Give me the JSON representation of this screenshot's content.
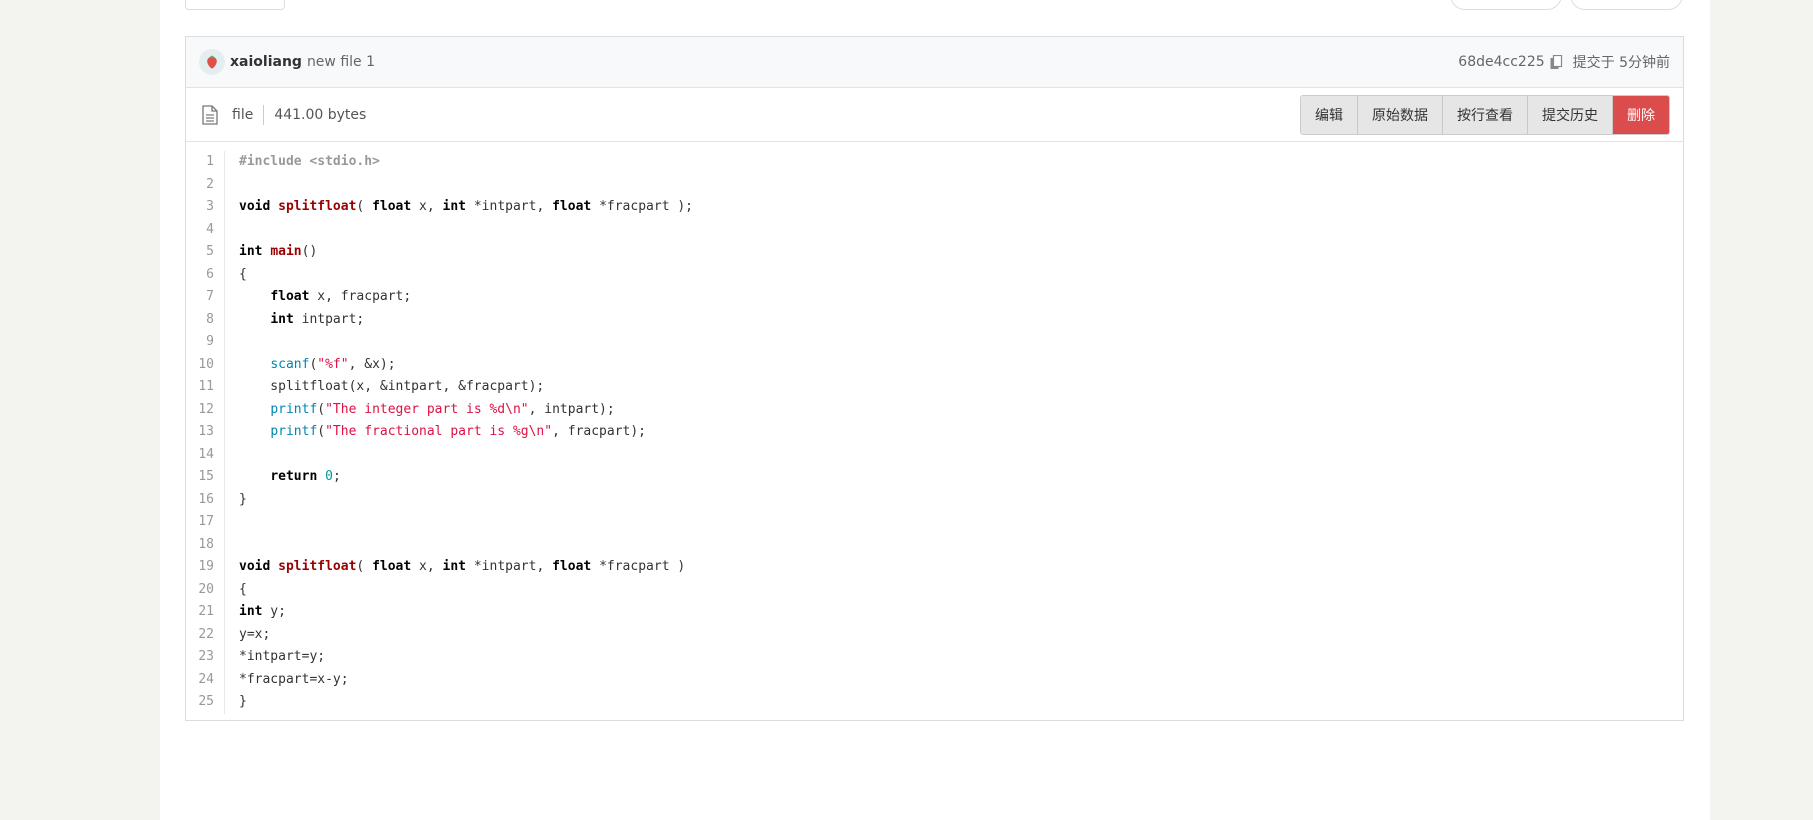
{
  "commit": {
    "author": "xaioliang",
    "message": "new file 1",
    "sha": "68de4cc225",
    "time": "提交于 5分钟前"
  },
  "file": {
    "name": "file",
    "size": "441.00 bytes"
  },
  "actions": {
    "edit": "编辑",
    "raw": "原始数据",
    "blame": "按行查看",
    "history": "提交历史",
    "delete": "删除"
  },
  "code": {
    "lines": [
      "#include <stdio.h>",
      "",
      "void splitfloat( float x, int *intpart, float *fracpart );",
      "",
      "int main()",
      "{",
      "    float x, fracpart;",
      "    int intpart;",
      "",
      "    scanf(\"%f\", &x);",
      "    splitfloat(x, &intpart, &fracpart);",
      "    printf(\"The integer part is %d\\n\", intpart);",
      "    printf(\"The fractional part is %g\\n\", fracpart);",
      "",
      "    return 0;",
      "}",
      "",
      "",
      "void splitfloat( float x, int *intpart, float *fracpart )",
      "{",
      "int y;",
      "y=x;",
      "*intpart=y;",
      "*fracpart=x-y;",
      "}"
    ]
  },
  "colors": {
    "delete_button": "#db4c4c",
    "keyword": "#000000",
    "function_name": "#990000",
    "string": "#dd1144",
    "builtin": "#0086b3"
  },
  "icons": [
    "avatar-strawberry-icon",
    "copy-icon",
    "file-icon"
  ]
}
